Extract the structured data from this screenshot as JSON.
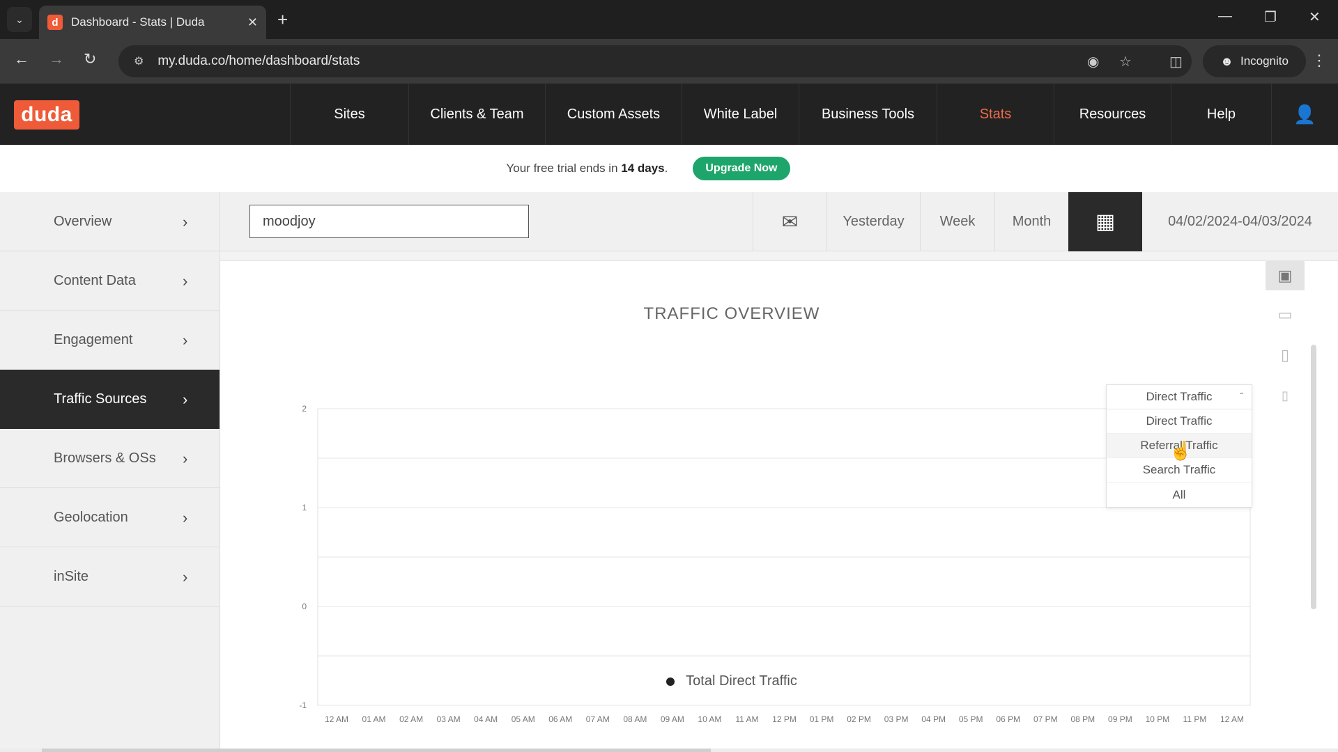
{
  "browser": {
    "tab_title": "Dashboard - Stats | Duda",
    "favicon_letter": "d",
    "url": "my.duda.co/home/dashboard/stats",
    "incognito_label": "Incognito"
  },
  "header": {
    "logo": "duda",
    "nav": [
      {
        "label": "Sites"
      },
      {
        "label": "Clients & Team"
      },
      {
        "label": "Custom Assets"
      },
      {
        "label": "White Label"
      },
      {
        "label": "Business Tools"
      },
      {
        "label": "Stats",
        "active": true
      },
      {
        "label": "Resources"
      },
      {
        "label": "Help"
      }
    ]
  },
  "trial": {
    "prefix": "Your free trial ends in ",
    "days": "14 days",
    "suffix": ".",
    "upgrade_label": "Upgrade Now"
  },
  "sidebar": {
    "items": [
      {
        "label": "Overview"
      },
      {
        "label": "Content Data"
      },
      {
        "label": "Engagement"
      },
      {
        "label": "Traffic Sources",
        "active": true
      },
      {
        "label": "Browsers & OSs"
      },
      {
        "label": "Geolocation"
      },
      {
        "label": "inSite"
      }
    ]
  },
  "toolbar": {
    "site_value": "moodjoy",
    "yesterday_label": "Yesterday",
    "week_label": "Week",
    "month_label": "Month",
    "date_range": "04/02/2024-04/03/2024"
  },
  "chart_data": {
    "type": "line",
    "title": "TRAFFIC OVERVIEW",
    "x": [
      "12 AM",
      "01 AM",
      "02 AM",
      "03 AM",
      "04 AM",
      "05 AM",
      "06 AM",
      "07 AM",
      "08 AM",
      "09 AM",
      "10 AM",
      "11 AM",
      "12 PM",
      "01 PM",
      "02 PM",
      "03 PM",
      "04 PM",
      "05 PM",
      "06 PM",
      "07 PM",
      "08 PM",
      "09 PM",
      "10 PM",
      "11 PM",
      "12 AM"
    ],
    "y_ticks": [
      "2",
      "1",
      "0",
      "-1"
    ],
    "ylim": [
      -1,
      2
    ],
    "series": [
      {
        "name": "Total Direct Traffic",
        "values": []
      }
    ],
    "grid": true,
    "legend": "bottom-center",
    "series_color": "#222222"
  },
  "traffic_dropdown": {
    "selected": "Direct Traffic",
    "options": [
      "Direct Traffic",
      "Referral Traffic",
      "Search Traffic",
      "All"
    ],
    "hovered_index": 1
  },
  "colors": {
    "brand": "#ef5b38",
    "active_nav": "#f06b4a",
    "upgrade": "#1ea56b",
    "dark": "#2a2a2a"
  }
}
